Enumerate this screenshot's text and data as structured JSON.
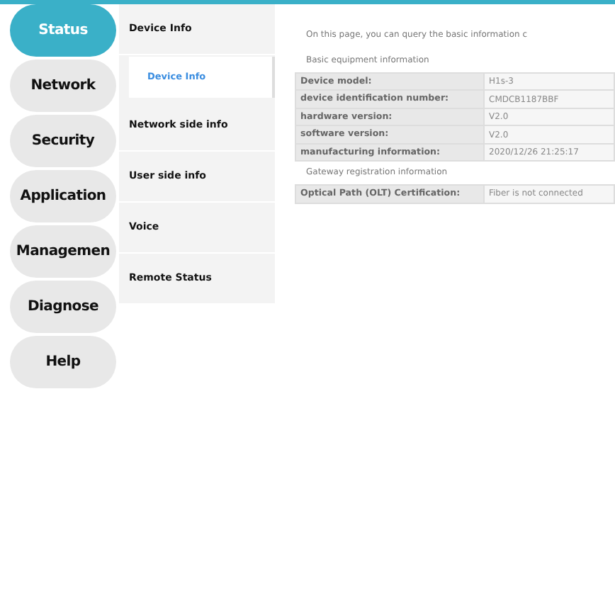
{
  "nav": [
    {
      "label": "Status",
      "selected": true
    },
    {
      "label": "Network",
      "selected": false
    },
    {
      "label": "Security",
      "selected": false
    },
    {
      "label": "Application",
      "selected": false
    },
    {
      "label": "Managemen",
      "selected": false
    },
    {
      "label": "Diagnose",
      "selected": false
    },
    {
      "label": "Help",
      "selected": false
    }
  ],
  "submenu": [
    {
      "label": "Device Info",
      "children": [
        {
          "label": "Device Info",
          "selected": true
        }
      ]
    },
    {
      "label": "Network side info"
    },
    {
      "label": "User side info"
    },
    {
      "label": "Voice"
    },
    {
      "label": "Remote Status"
    }
  ],
  "intro": "On this page, you can query the basic information c",
  "sections": [
    {
      "title": "Basic equipment information",
      "rows": [
        {
          "label": "Device model:",
          "value": "H1s-3"
        },
        {
          "label": "device identification number:",
          "value": "CMDCB1187BBF"
        },
        {
          "label": "hardware version:",
          "value": "V2.0"
        },
        {
          "label": "software version:",
          "value": "V2.0"
        },
        {
          "label": "manufacturing information:",
          "value": "2020/12/26 21:25:17"
        }
      ]
    },
    {
      "title": "Gateway registration information",
      "rows": [
        {
          "label": "Optical Path (OLT) Certification:",
          "value": "Fiber is not connected"
        }
      ]
    }
  ]
}
